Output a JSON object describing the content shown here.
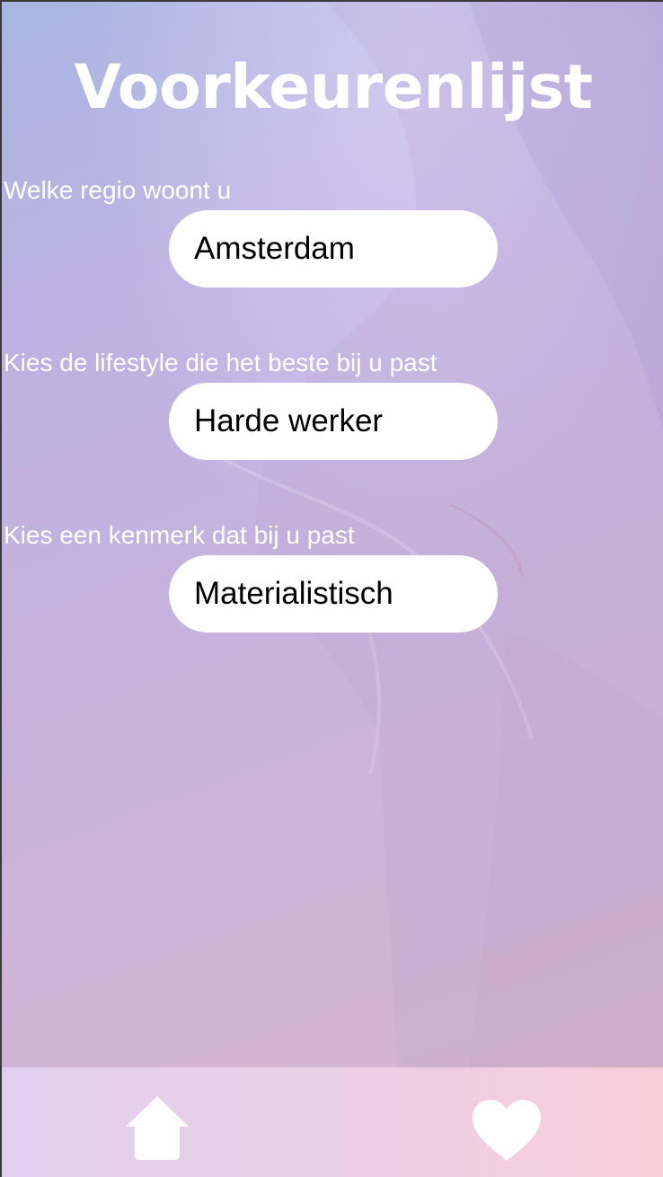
{
  "page": {
    "title": "Voorkeurenlijst"
  },
  "questions": [
    {
      "label": "Welke regio woont u",
      "value": "Amsterdam"
    },
    {
      "label": "Kies de lifestyle die het beste bij u past",
      "value": "Harde werker"
    },
    {
      "label": "Kies een kenmerk dat bij u past",
      "value": "Materialistisch"
    }
  ],
  "nav": {
    "items": [
      {
        "icon": "home-icon"
      },
      {
        "icon": "heart-icon"
      }
    ]
  },
  "colors": {
    "background_gradient": [
      "#a9b6e2",
      "#c7b3dd",
      "#d7b5cc"
    ],
    "nav_gradient": [
      "#e2cff0",
      "#f8cdd8"
    ],
    "text": "#ffffff",
    "field": "#ffffff"
  }
}
